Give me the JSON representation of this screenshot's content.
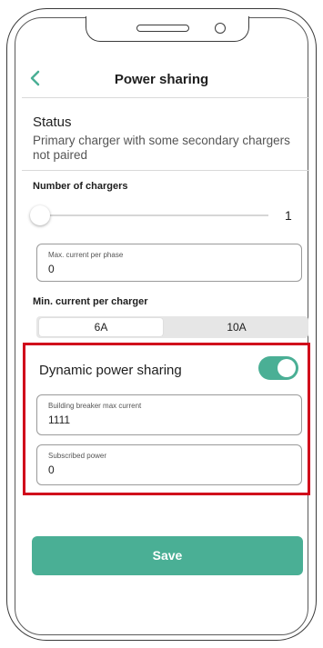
{
  "header": {
    "title": "Power sharing",
    "back_icon": "chevron-left-icon",
    "accent_color": "#4aaf95"
  },
  "status": {
    "label": "Status",
    "text": "Primary charger with some secondary chargers not paired"
  },
  "chargers": {
    "label": "Number of chargers",
    "value": "1"
  },
  "max_current": {
    "label": "Max. current per phase",
    "value": "0"
  },
  "min_current": {
    "label": "Min. current per charger",
    "options": [
      "6A",
      "10A"
    ],
    "selected": "6A"
  },
  "dynamic": {
    "label": "Dynamic power sharing",
    "enabled": true,
    "highlight_color": "#d0021b"
  },
  "building_breaker": {
    "label": "Building breaker max current",
    "value": "1111"
  },
  "subscribed_power": {
    "label": "Subscribed power",
    "value": "0"
  },
  "save_label": "Save"
}
